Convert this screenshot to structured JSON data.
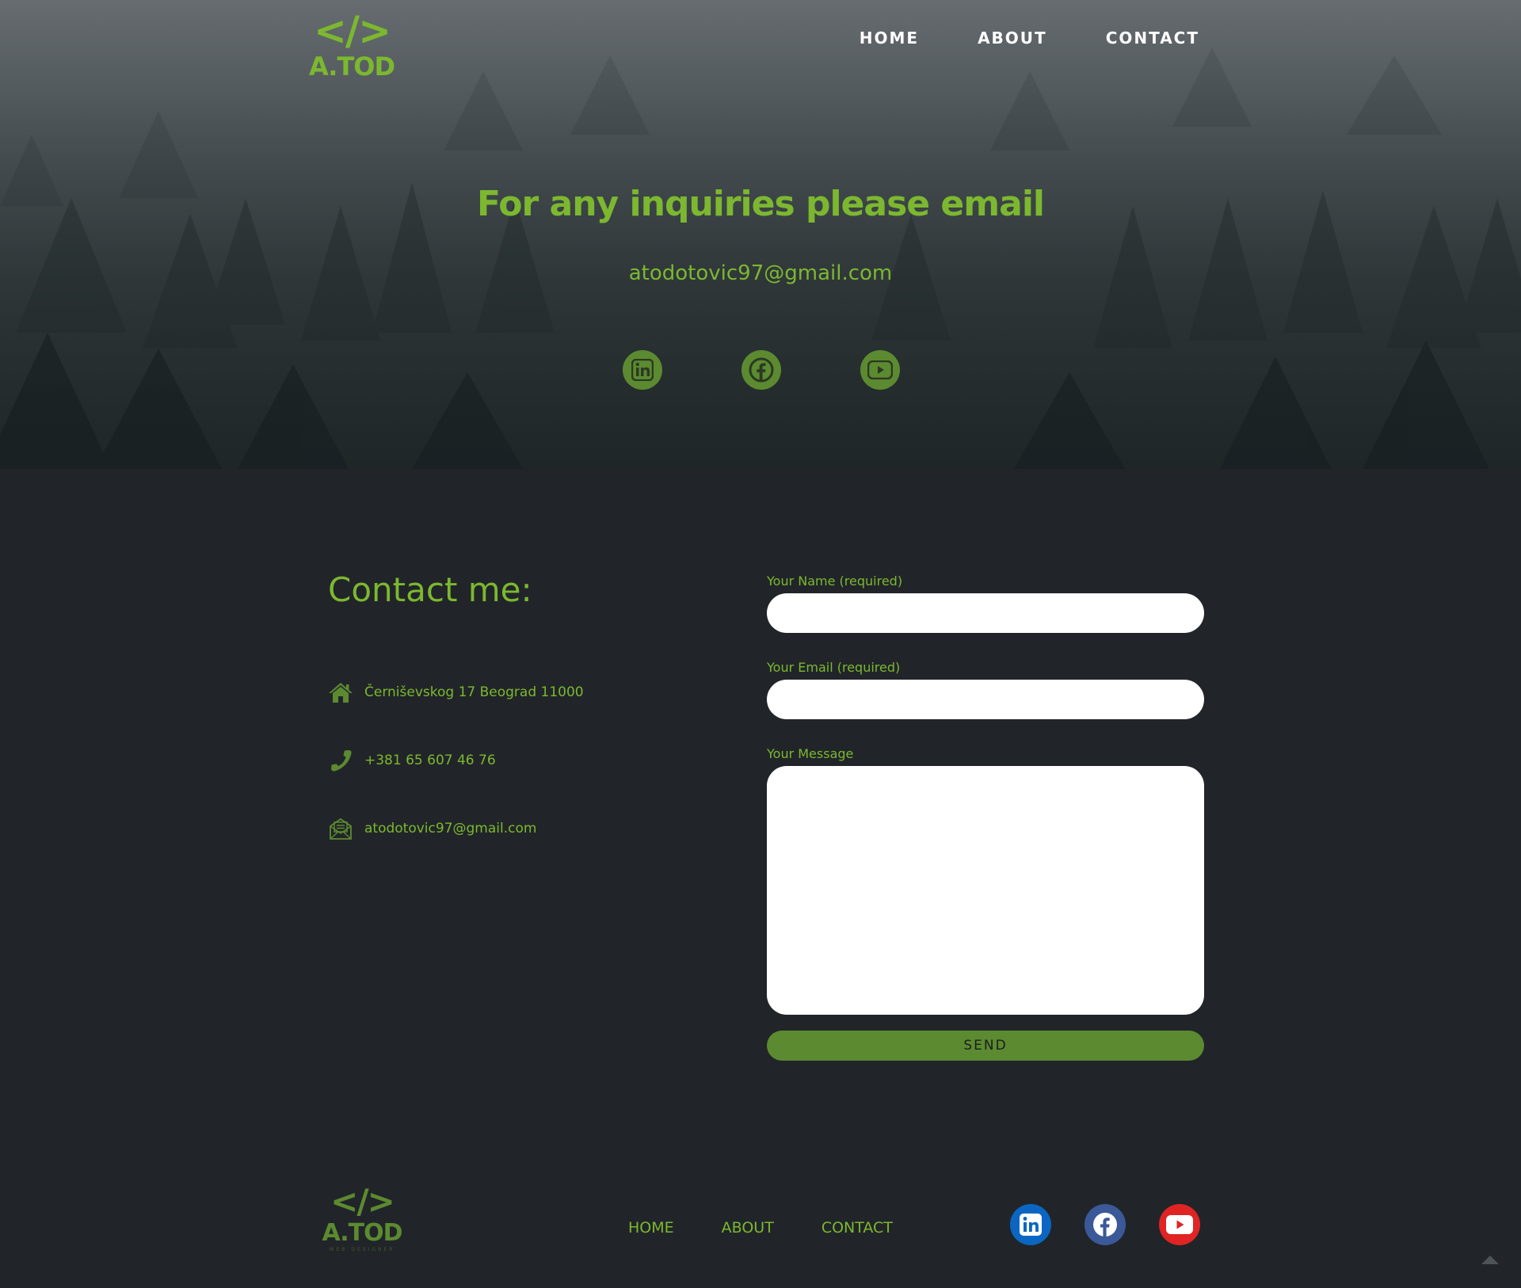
{
  "brand": {
    "logo_code": "</>",
    "logo_text": "A.TOD",
    "footer_logo_sub": "WEB DESIGNER"
  },
  "nav": {
    "items": [
      "HOME",
      "ABOUT",
      "CONTACT"
    ]
  },
  "hero": {
    "title": "For any inquiries please email",
    "email": "atodotovic97@gmail.com",
    "social_icons": [
      "linkedin-icon",
      "facebook-icon",
      "youtube-icon"
    ]
  },
  "contact": {
    "heading": "Contact me:",
    "address": "Černiševskog 17 Beograd 11000",
    "phone": "+381 65 607 46 76",
    "email": "atodotovic97@gmail.com",
    "icons": [
      "home-icon",
      "phone-icon",
      "mail-icon"
    ]
  },
  "form": {
    "name_label": "Your Name (required)",
    "email_label": "Your Email (required)",
    "message_label": "Your Message",
    "name_value": "",
    "email_value": "",
    "message_value": "",
    "send_label": "SEND"
  },
  "footer": {
    "nav_items": [
      "HOME",
      "ABOUT",
      "CONTACT"
    ],
    "social_icons": [
      "linkedin-icon",
      "facebook-icon",
      "youtube-icon"
    ]
  },
  "colors": {
    "accent": "#7cb82f",
    "accent_dark": "#5c8a30",
    "background": "#212529",
    "linkedin": "#0a66c2",
    "facebook": "#3b5998",
    "youtube": "#e02424"
  }
}
